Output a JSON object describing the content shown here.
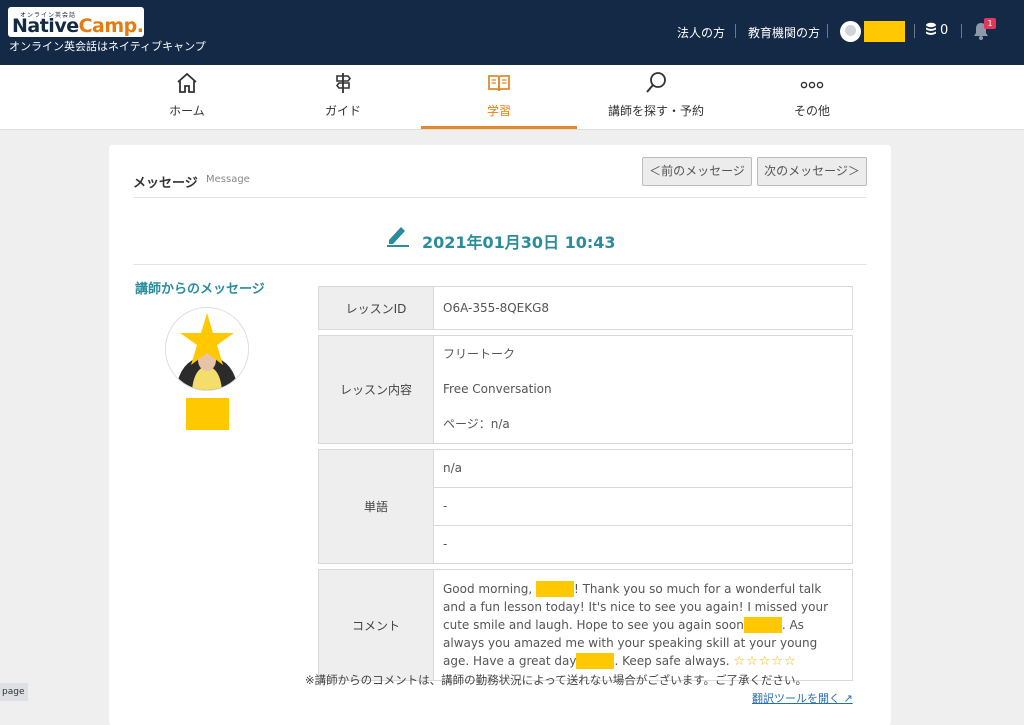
{
  "header": {
    "logo_small": "オンライン英会話",
    "logo_native": "Native",
    "logo_camp": "Camp.",
    "tagline": "オンライン英会話はネイティブキャンプ",
    "link_corporate": "法人の方",
    "link_education": "教育機関の方",
    "coin_count": "0",
    "notification_count": "1"
  },
  "nav": {
    "items": [
      {
        "label": "ホーム",
        "icon": "home-icon"
      },
      {
        "label": "ガイド",
        "icon": "signpost-icon"
      },
      {
        "label": "学習",
        "icon": "book-icon"
      },
      {
        "label": "講師を探す・予約",
        "icon": "search-icon"
      },
      {
        "label": "その他",
        "icon": "more-icon"
      }
    ],
    "active": "学習",
    "active_color": "#e4892b"
  },
  "card": {
    "title": "メッセージ",
    "subtitle": "Message",
    "prev_button": "＜前のメッセージ",
    "next_button": "次のメッセージ＞",
    "date": "2021年01月30日 10:43",
    "teacher_heading": "講師からのメッセージ"
  },
  "details": {
    "lesson_id_label": "レッスンID",
    "lesson_id": "O6A-355-8QEKG8",
    "content_label": "レッスン内容",
    "content_jp": "フリートーク",
    "content_en": "Free Conversation",
    "content_page": "ページ：n/a",
    "vocab_label": "単語",
    "vocab": [
      "n/a",
      "-",
      "-"
    ],
    "comment_label": "コメント",
    "comment_1": "Good morning, ",
    "comment_2": "! Thank you so much for a wonderful talk and a fun lesson today! It's nice to see you again! I missed your cute smile and laugh. Hope to see you again soon",
    "comment_3": ". As always you amazed me with your speaking skill at your young age. Have a great day",
    "comment_4": ". Keep safe always. ",
    "comment_stars": "☆☆☆☆☆"
  },
  "footer": {
    "note": "※講師からのコメントは、講師の勤務状況によって送れない場合がございます。ご了承ください。",
    "translate_link": "翻訳ツールを開く",
    "page_tag": "page"
  },
  "colors": {
    "header_bg": "#142945",
    "accent_teal": "#2a8c9c",
    "accent_orange": "#e47d10",
    "redaction": "#ffc800"
  }
}
